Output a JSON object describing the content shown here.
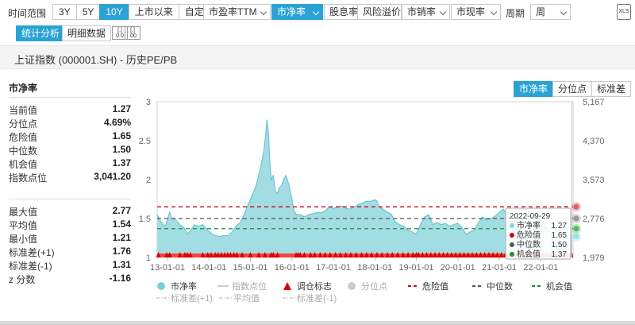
{
  "toolbar": {
    "time_range_label": "时间范围",
    "time_ranges": [
      "3Y",
      "5Y",
      "10Y",
      "上市以来",
      "自定义"
    ],
    "time_range_active": 2,
    "metrics": [
      "市盈率TTM",
      "市净率",
      "股息率",
      "风险溢价",
      "市销率",
      "市现率"
    ],
    "metric_active": 1,
    "metric_has_dropdown": [
      true,
      true,
      false,
      false,
      true,
      true
    ],
    "period_label": "周期",
    "period_value": "周",
    "export_icon": "excel-export-icon",
    "export_text": "XLS"
  },
  "subtabs": [
    "统计分析",
    "明细数据"
  ],
  "subtab_active": 0,
  "zoom_buttons": [
    {
      "icon": "zoom-out-icon",
      "top": "[.]",
      "bottom": "0.0"
    },
    {
      "icon": "zoom-in-icon",
      "top": "[.]",
      "bottom": ".00"
    }
  ],
  "chart_title": "上证指数 (000001.SH) - 历史PE/PB",
  "stats": {
    "heading": "市净率",
    "group1": [
      {
        "label": "当前值",
        "value": "1.27"
      },
      {
        "label": "分位点",
        "value": "4.69%"
      },
      {
        "label": "危险值",
        "value": "1.65"
      },
      {
        "label": "中位数",
        "value": "1.50"
      },
      {
        "label": "机会值",
        "value": "1.37"
      },
      {
        "label": "指数点位",
        "value": "3,041.20"
      }
    ],
    "group2": [
      {
        "label": "最大值",
        "value": "2.77"
      },
      {
        "label": "平均值",
        "value": "1.54"
      },
      {
        "label": "最小值",
        "value": "1.21"
      },
      {
        "label": "标准差(+1)",
        "value": "1.76"
      },
      {
        "label": "标准差(-1)",
        "value": "1.31"
      },
      {
        "label": "z 分数",
        "value": "-1.16"
      }
    ]
  },
  "right_buttons": [
    "市净率",
    "分位点",
    "标准差"
  ],
  "right_button_active": 0,
  "tooltip": {
    "date": "2022-09-29",
    "rows": [
      {
        "label": "市净率",
        "value": "1.27",
        "color": "#8ad3dd"
      },
      {
        "label": "危险值",
        "value": "1.65",
        "color": "#d0021b"
      },
      {
        "label": "中位数",
        "value": "1.50",
        "color": "#555555"
      },
      {
        "label": "机会值",
        "value": "1.37",
        "color": "#1e8c3a"
      }
    ]
  },
  "legend": {
    "row1": [
      {
        "name": "市净率",
        "type": "dot",
        "color": "#7ccfd9",
        "active": true
      },
      {
        "name": "指数点位",
        "type": "line",
        "color": "#cccccc",
        "active": false
      },
      {
        "name": "调仓标志",
        "type": "triangle",
        "color": "#e00000",
        "active": true
      },
      {
        "name": "分位点",
        "type": "dot",
        "color": "#cccccc",
        "active": false
      },
      {
        "name": "危险值",
        "type": "dash",
        "color": "#d0021b",
        "active": true
      },
      {
        "name": "中位数",
        "type": "dash",
        "color": "#555555",
        "active": true
      },
      {
        "name": "机会值",
        "type": "dash",
        "color": "#1e8c3a",
        "active": true
      }
    ],
    "row2": [
      {
        "name": "标准差(+1)",
        "type": "dashdot",
        "color": "#cccccc",
        "active": false
      },
      {
        "name": "平均值",
        "type": "dashdot",
        "color": "#cccccc",
        "active": false
      },
      {
        "name": "标准差(-1)",
        "type": "dashdot",
        "color": "#cccccc",
        "active": false
      }
    ]
  },
  "chart_data": {
    "type": "area",
    "series_name": "市净率",
    "x_ticks": [
      "13-01-01",
      "14-01-01",
      "15-01-01",
      "16-01-01",
      "17-01-01",
      "18-01-01",
      "19-01-01",
      "20-01-01",
      "21-01-01",
      "22-01-01"
    ],
    "x_tick_years": [
      2013,
      2014,
      2015,
      2016,
      2017,
      2018,
      2019,
      2020,
      2021,
      2022
    ],
    "x_range_years": [
      2012.75,
      2022.78
    ],
    "y_left_ticks": [
      "1",
      "1.5",
      "2",
      "2.5",
      "3"
    ],
    "y_left_range": [
      1,
      3
    ],
    "y_right_ticks": [
      "1,979",
      "2,776",
      "3,573",
      "4,370",
      "5,167"
    ],
    "reference_lines": {
      "danger": 1.65,
      "median": 1.5,
      "opportunity": 1.37
    },
    "colors": {
      "area": "#a3dde4",
      "line": "#6cc5d1",
      "danger": "#d0021b",
      "median": "#555555",
      "opportunity": "#1e8c3a",
      "marker": "#e00000"
    },
    "pb_points": [
      [
        2012.75,
        1.55
      ],
      [
        2012.85,
        1.45
      ],
      [
        2012.95,
        1.4
      ],
      [
        2013.05,
        1.58
      ],
      [
        2013.1,
        1.5
      ],
      [
        2013.2,
        1.48
      ],
      [
        2013.3,
        1.42
      ],
      [
        2013.4,
        1.38
      ],
      [
        2013.47,
        1.3
      ],
      [
        2013.55,
        1.34
      ],
      [
        2013.65,
        1.42
      ],
      [
        2013.75,
        1.4
      ],
      [
        2013.85,
        1.42
      ],
      [
        2013.95,
        1.36
      ],
      [
        2014.05,
        1.31
      ],
      [
        2014.15,
        1.28
      ],
      [
        2014.25,
        1.27
      ],
      [
        2014.35,
        1.28
      ],
      [
        2014.45,
        1.28
      ],
      [
        2014.55,
        1.32
      ],
      [
        2014.65,
        1.4
      ],
      [
        2014.75,
        1.45
      ],
      [
        2014.85,
        1.55
      ],
      [
        2014.92,
        1.65
      ],
      [
        2015.0,
        1.75
      ],
      [
        2015.08,
        1.85
      ],
      [
        2015.15,
        1.95
      ],
      [
        2015.22,
        2.1
      ],
      [
        2015.28,
        2.25
      ],
      [
        2015.33,
        2.4
      ],
      [
        2015.37,
        2.6
      ],
      [
        2015.4,
        2.77
      ],
      [
        2015.44,
        2.55
      ],
      [
        2015.47,
        2.2
      ],
      [
        2015.5,
        2.0
      ],
      [
        2015.55,
        2.05
      ],
      [
        2015.6,
        1.85
      ],
      [
        2015.65,
        1.82
      ],
      [
        2015.7,
        1.9
      ],
      [
        2015.75,
        1.92
      ],
      [
        2015.8,
        2.0
      ],
      [
        2015.85,
        2.05
      ],
      [
        2015.92,
        1.95
      ],
      [
        2016.0,
        1.75
      ],
      [
        2016.05,
        1.6
      ],
      [
        2016.1,
        1.55
      ],
      [
        2016.2,
        1.55
      ],
      [
        2016.3,
        1.52
      ],
      [
        2016.4,
        1.55
      ],
      [
        2016.5,
        1.56
      ],
      [
        2016.6,
        1.58
      ],
      [
        2016.7,
        1.57
      ],
      [
        2016.8,
        1.6
      ],
      [
        2016.9,
        1.65
      ],
      [
        2017.0,
        1.63
      ],
      [
        2017.1,
        1.65
      ],
      [
        2017.2,
        1.66
      ],
      [
        2017.3,
        1.63
      ],
      [
        2017.4,
        1.62
      ],
      [
        2017.5,
        1.65
      ],
      [
        2017.6,
        1.68
      ],
      [
        2017.7,
        1.7
      ],
      [
        2017.8,
        1.72
      ],
      [
        2017.9,
        1.72
      ],
      [
        2018.0,
        1.74
      ],
      [
        2018.05,
        1.73
      ],
      [
        2018.1,
        1.65
      ],
      [
        2018.2,
        1.62
      ],
      [
        2018.3,
        1.58
      ],
      [
        2018.4,
        1.55
      ],
      [
        2018.5,
        1.45
      ],
      [
        2018.6,
        1.42
      ],
      [
        2018.7,
        1.4
      ],
      [
        2018.8,
        1.35
      ],
      [
        2018.9,
        1.33
      ],
      [
        2019.0,
        1.3
      ],
      [
        2019.1,
        1.42
      ],
      [
        2019.2,
        1.52
      ],
      [
        2019.3,
        1.55
      ],
      [
        2019.4,
        1.42
      ],
      [
        2019.5,
        1.45
      ],
      [
        2019.6,
        1.42
      ],
      [
        2019.7,
        1.44
      ],
      [
        2019.8,
        1.4
      ],
      [
        2019.9,
        1.42
      ],
      [
        2020.0,
        1.44
      ],
      [
        2020.1,
        1.38
      ],
      [
        2020.2,
        1.3
      ],
      [
        2020.3,
        1.33
      ],
      [
        2020.4,
        1.35
      ],
      [
        2020.5,
        1.45
      ],
      [
        2020.6,
        1.52
      ],
      [
        2020.7,
        1.48
      ],
      [
        2020.8,
        1.5
      ],
      [
        2020.9,
        1.53
      ],
      [
        2021.0,
        1.58
      ],
      [
        2021.1,
        1.62
      ],
      [
        2021.2,
        1.52
      ],
      [
        2021.3,
        1.5
      ],
      [
        2021.4,
        1.52
      ],
      [
        2021.5,
        1.5
      ],
      [
        2021.6,
        1.47
      ],
      [
        2021.7,
        1.48
      ],
      [
        2021.8,
        1.5
      ],
      [
        2021.9,
        1.52
      ],
      [
        2022.0,
        1.5
      ],
      [
        2022.1,
        1.42
      ],
      [
        2022.2,
        1.35
      ],
      [
        2022.3,
        1.3
      ],
      [
        2022.4,
        1.36
      ],
      [
        2022.5,
        1.42
      ],
      [
        2022.6,
        1.38
      ],
      [
        2022.7,
        1.3
      ],
      [
        2022.75,
        1.27
      ]
    ],
    "rebalance_marker_years": [
      2012.78,
      2012.98,
      2013.05,
      2013.3,
      2013.42,
      2013.48,
      2013.55,
      2013.85,
      2013.97,
      2014.05,
      2014.15,
      2014.22,
      2014.3,
      2014.38,
      2014.45,
      2014.52,
      2014.6,
      2014.67,
      2014.8,
      2015.0,
      2015.2,
      2015.35,
      2015.5,
      2015.55,
      2015.65,
      2016.1,
      2016.15,
      2016.2,
      2016.3,
      2016.45,
      2016.55,
      2016.68,
      2016.8,
      2016.92,
      2017.05,
      2017.17,
      2017.3,
      2017.42,
      2017.55,
      2017.68,
      2017.8,
      2017.92,
      2018.05,
      2018.17,
      2018.3,
      2018.42,
      2018.55,
      2018.68,
      2018.8,
      2018.92,
      2019.0,
      2019.05,
      2019.15,
      2019.25,
      2019.35,
      2019.45,
      2019.55,
      2019.65,
      2019.75,
      2019.85,
      2019.95,
      2020.05,
      2020.15,
      2020.25,
      2020.35,
      2020.45,
      2020.55,
      2020.65,
      2020.75,
      2020.85,
      2020.95,
      2021.05,
      2021.15,
      2021.25,
      2021.35,
      2021.45,
      2021.55,
      2021.65,
      2021.75,
      2021.85,
      2021.95,
      2022.05,
      2022.15,
      2022.25,
      2022.35,
      2022.45,
      2022.55,
      2022.65,
      2022.73
    ]
  }
}
